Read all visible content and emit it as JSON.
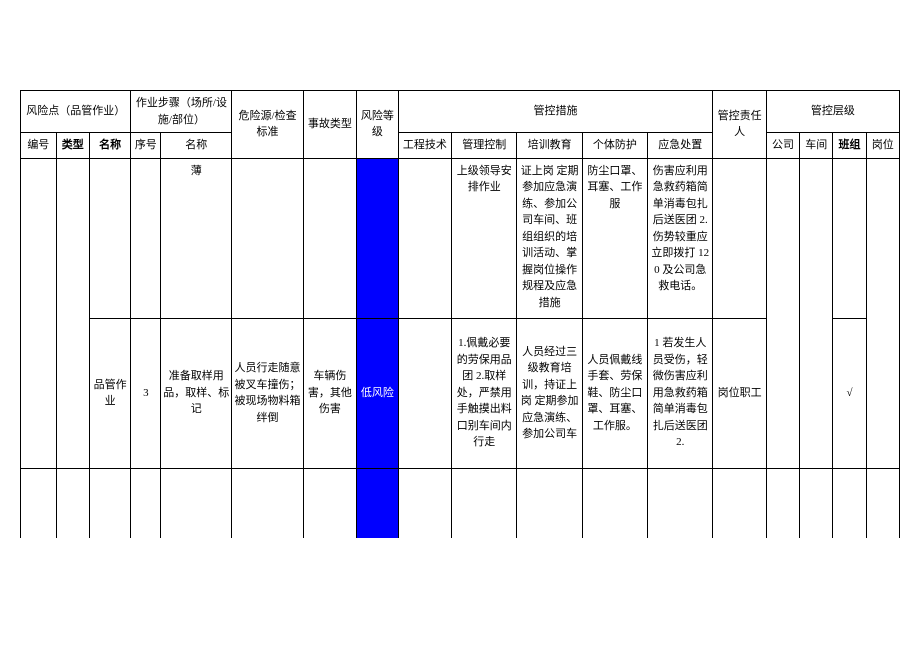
{
  "header": {
    "risk_point_group": "风险点（品管作业）",
    "work_step_group": "作业步骤（场所/设施/部位）",
    "hazard_standard": "危险源/检查标准",
    "accident_type": "事故类型",
    "risk_level": "风险等级",
    "control_measure_group": "管控措施",
    "control_responsible": "管控责任人",
    "control_level_group": "管控层级",
    "bianhao": "编号",
    "leixing": "类型",
    "mingcheng": "名称",
    "xuhao": "序号",
    "buzhou_mingcheng": "名称",
    "gongcheng": "工程技术",
    "guanli": "管理控制",
    "peixun": "培训教育",
    "geti": "个体防护",
    "yingji": "应急处置",
    "gongsi": "公司",
    "chejian": "车间",
    "banzu": "班组",
    "gangwei": "岗位"
  },
  "rows": [
    {
      "mingcheng": "",
      "xuhao": "",
      "buzhou": "薄",
      "weixian": "",
      "shigu": "",
      "dengji": "",
      "gongcheng": "",
      "guanli": "上级领导安排作业",
      "peixun": "证上岗 定期参加应急演练、参加公司车间、班组组织的培训活动、掌握岗位操作规程及应急措施",
      "geti": "防尘口罩、耳塞、工作服",
      "yingji": "伤害应利用急救药箱简单消毒包扎后送医团 2.伤势较重应立即拨打 120 及公司急救电话。",
      "zeren": "",
      "banzu_check": ""
    },
    {
      "mingcheng": "品管作业",
      "xuhao": "3",
      "buzhou": "准备取样用品，取样、标记",
      "weixian": "人员行走随意被叉车撞伤；被现场物料箱绊倒",
      "shigu": "车辆伤害，其他伤害",
      "dengji": "低风险",
      "gongcheng": "",
      "guanli": "1.佩戴必要的劳保用品团 2.取样处，严禁用手触摸出料口别车间内行走",
      "peixun": "人员经过三级教育培训，持证上岗 定期参加应急演练、参加公司车",
      "geti": "人员佩戴线手套、劳保鞋、防尘口罩、耳塞、工作服。",
      "yingji": "1 若发生人员受伤，轻微伤害应利用急救药箱简单消毒包扎后送医团 2.",
      "zeren": "岗位职工",
      "banzu_check": "√"
    }
  ]
}
